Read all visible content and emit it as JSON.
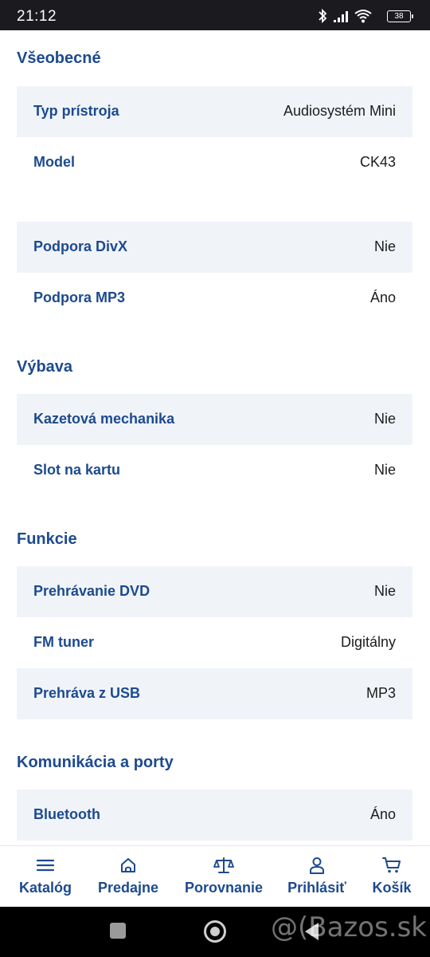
{
  "status_bar": {
    "time": "21:12",
    "battery": "38",
    "icons": [
      "bluetooth-icon",
      "signal-icon",
      "wifi-icon",
      "battery-icon"
    ]
  },
  "sections": {
    "vseobecne": {
      "title": "Všeobecné",
      "rows": [
        {
          "label": "Typ prístroja",
          "value": "Audiosystém Mini"
        },
        {
          "label": "Model",
          "value": "CK43"
        }
      ]
    },
    "formaty": {
      "rows": [
        {
          "label": "Podpora DivX",
          "value": "Nie"
        },
        {
          "label": "Podpora MP3",
          "value": "Áno"
        }
      ]
    },
    "vybava": {
      "title": "Výbava",
      "rows": [
        {
          "label": "Kazetová mechanika",
          "value": "Nie"
        },
        {
          "label": "Slot na kartu",
          "value": "Nie"
        }
      ]
    },
    "funkcie": {
      "title": "Funkcie",
      "rows": [
        {
          "label": "Prehrávanie DVD",
          "value": "Nie"
        },
        {
          "label": "FM tuner",
          "value": "Digitálny"
        },
        {
          "label": "Prehráva z USB",
          "value": "MP3"
        }
      ]
    },
    "komunikacia": {
      "title": "Komunikácia a porty",
      "rows": [
        {
          "label": "Bluetooth",
          "value": "Áno"
        }
      ]
    }
  },
  "bottom_nav": [
    {
      "label": "Katalóg",
      "icon": "menu-icon"
    },
    {
      "label": "Predajne",
      "icon": "store-icon"
    },
    {
      "label": "Porovnanie",
      "icon": "scale-icon"
    },
    {
      "label": "Prihlásiť",
      "icon": "user-icon"
    },
    {
      "label": "Košík",
      "icon": "cart-icon"
    }
  ],
  "watermark": "@(Bazos.sk",
  "colors": {
    "accent": "#1d4a8f",
    "row_shade": "#f0f4f9",
    "status_bar": "#1b1b1f"
  }
}
